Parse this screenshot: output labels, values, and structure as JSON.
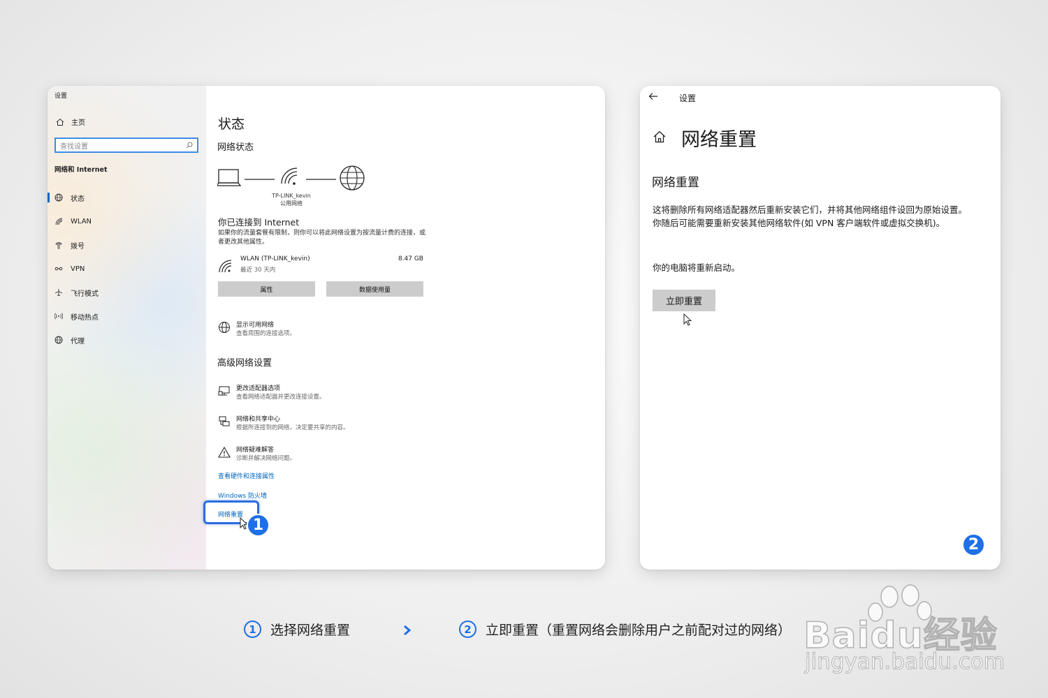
{
  "window1": {
    "title": "设置",
    "sidebar": {
      "home_label": "主页",
      "search_placeholder": "查找设置",
      "section_title": "网络和 Internet",
      "items": [
        {
          "label": "状态",
          "icon": "globe-status-icon"
        },
        {
          "label": "WLAN",
          "icon": "wifi-icon"
        },
        {
          "label": "拨号",
          "icon": "phone-dialup-icon"
        },
        {
          "label": "VPN",
          "icon": "vpn-icon"
        },
        {
          "label": "飞行模式",
          "icon": "airplane-icon"
        },
        {
          "label": "移动热点",
          "icon": "hotspot-icon"
        },
        {
          "label": "代理",
          "icon": "proxy-globe-icon"
        }
      ]
    },
    "main": {
      "title": "状态",
      "network_status_heading": "网络状态",
      "ssid": "TP-LINK_kevin",
      "network_type": "公用网络",
      "connected_title": "你已连接到 Internet",
      "connected_desc": "如果你的流量套餐有限制，则你可以将此网络设置为按流量计费的连接，或者更改其他属性。",
      "connection": {
        "name": "WLAN (TP-LINK_kevin)",
        "period": "最近 30 天内",
        "usage": "8.47 GB"
      },
      "buttons": {
        "properties": "属性",
        "data_usage": "数据使用量"
      },
      "show_networks": {
        "title": "显示可用网络",
        "desc": "查看周围的连接选项。"
      },
      "advanced_heading": "高级网络设置",
      "advanced_options": [
        {
          "title": "更改适配器选项",
          "desc": "查看网络适配器并更改连接设置。"
        },
        {
          "title": "网络和共享中心",
          "desc": "根据所连接到的网络，决定要共享的内容。"
        },
        {
          "title": "网络疑难解答",
          "desc": "诊断并解决网络问题。"
        }
      ],
      "links": {
        "hardware": "查看硬件和连接属性",
        "firewall": "Windows 防火墙",
        "reset": "网络重置"
      }
    },
    "badge": "1"
  },
  "window2": {
    "title": "设置",
    "page_title": "网络重置",
    "section_title": "网络重置",
    "description": "这将删除所有网络适配器然后重新安装它们，并将其他网络组件设回为原始设置。你随后可能需要重新安装其他网络软件(如 VPN 客户端软件或虚拟交换机)。",
    "restart_note": "你的电脑将重新启动。",
    "reset_button": "立即重置",
    "badge": "2"
  },
  "caption": {
    "step1_number": "1",
    "step1_text": "选择网络重置",
    "step2_number": "2",
    "step2_text": "立即重置（重置网络会删除用户之前配对过的网络）"
  },
  "watermark": {
    "brand": "Baidu经验",
    "url": "jingyan.baidu.com"
  },
  "colors": {
    "accent": "#0067c0",
    "badge_blue": "#1f6fe6",
    "button_gray": "#cccccc"
  }
}
